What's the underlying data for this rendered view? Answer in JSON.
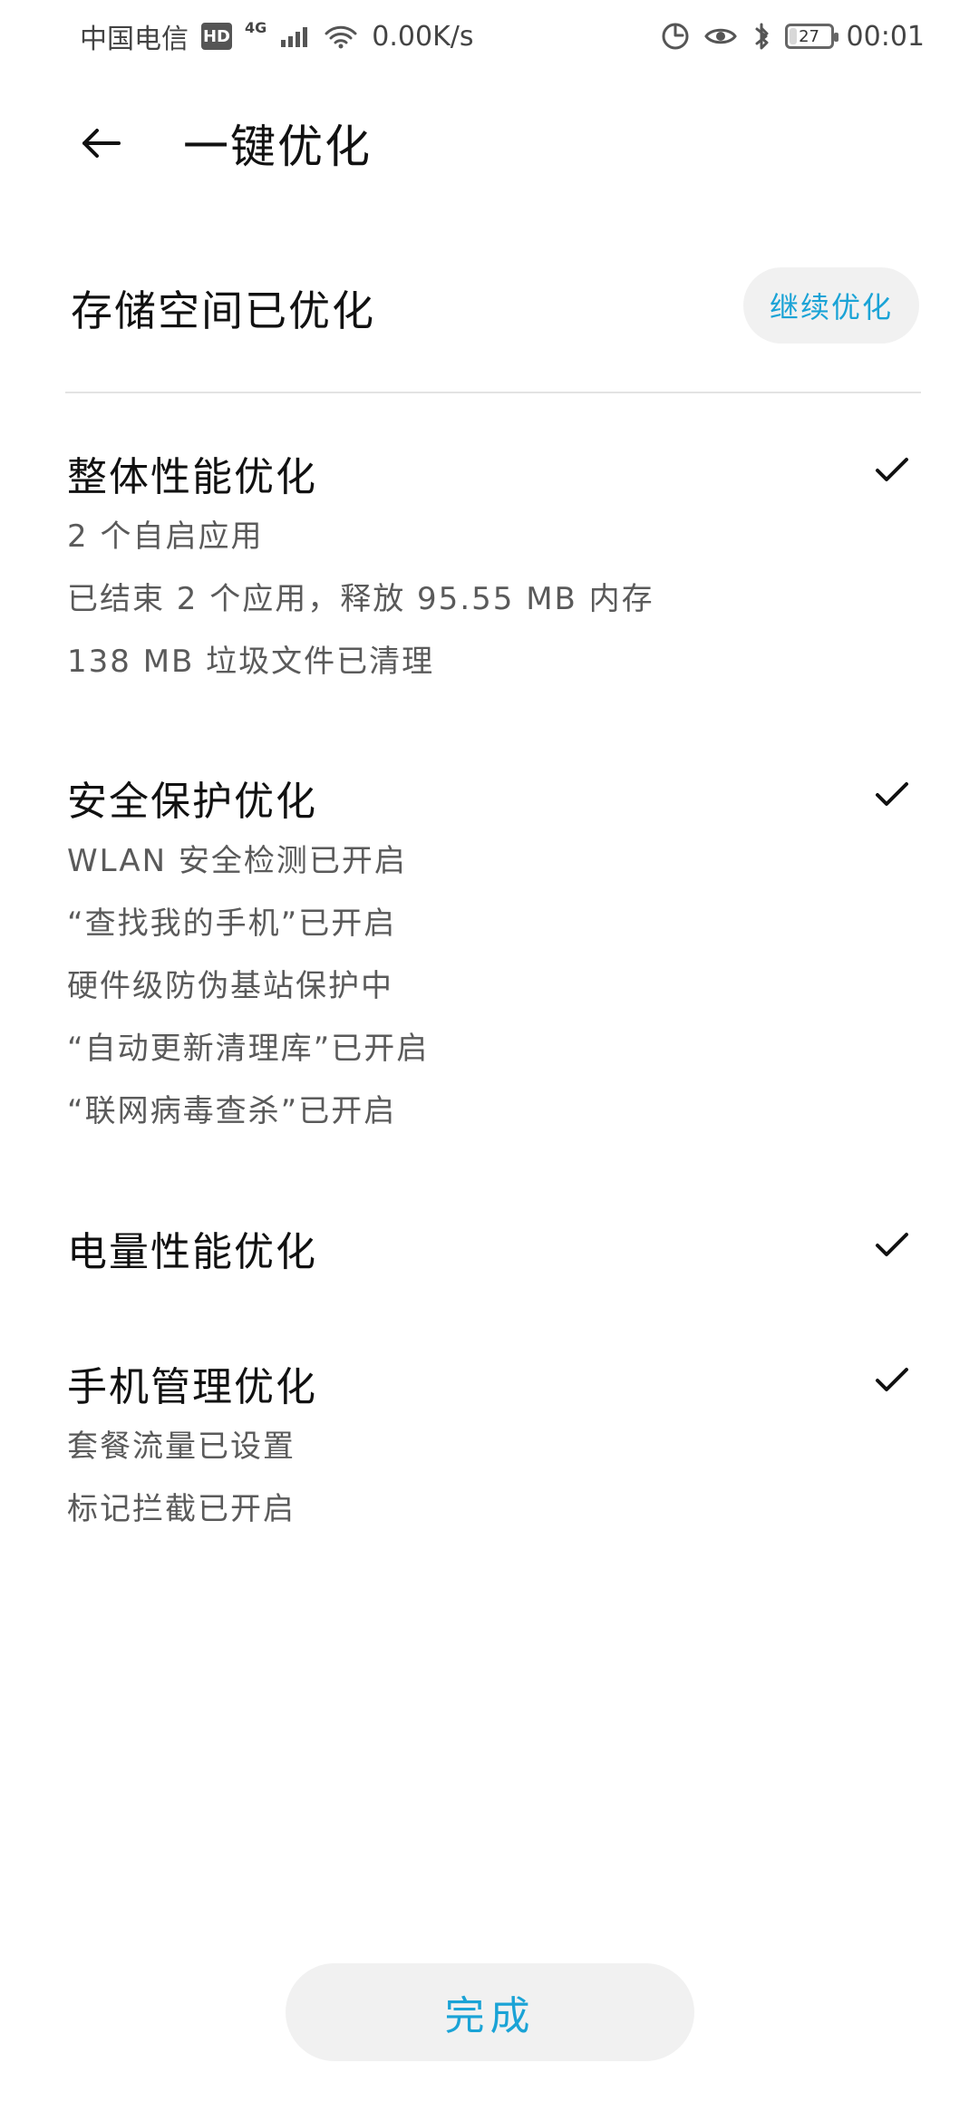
{
  "status_bar": {
    "carrier": "中国电信",
    "hd": "HD",
    "network": "4G",
    "speed": "0.00K/s",
    "battery": "27",
    "time": "00:01",
    "icons": [
      "hd-icon",
      "signal-icon",
      "wifi-icon",
      "data-saver-icon",
      "eye-comfort-icon",
      "bluetooth-icon",
      "battery-icon"
    ]
  },
  "header": {
    "title": "一键优化",
    "back_icon": "back-arrow-icon"
  },
  "storage": {
    "title": "存储空间已优化",
    "continue_button": "继续优化"
  },
  "groups": [
    {
      "title": "整体性能优化",
      "lines": [
        "2 个自启应用",
        "已结束 2 个应用，释放 95.55 MB 内存",
        "138 MB 垃圾文件已清理"
      ]
    },
    {
      "title": "安全保护优化",
      "lines": [
        "WLAN 安全检测已开启",
        "“查找我的手机”已开启",
        "硬件级防伪基站保护中",
        "“自动更新清理库”已开启",
        "“联网病毒查杀”已开启"
      ]
    },
    {
      "title": "电量性能优化",
      "lines": []
    },
    {
      "title": "手机管理优化",
      "lines": [
        "套餐流量已设置",
        "标记拦截已开启"
      ]
    }
  ],
  "done_button": "完成",
  "colors": {
    "accent": "#1aa3d6",
    "pill_bg": "#f1f1f1",
    "divider": "#e3e3e3",
    "text": "#111111",
    "muted_text": "#5a5a5a"
  }
}
